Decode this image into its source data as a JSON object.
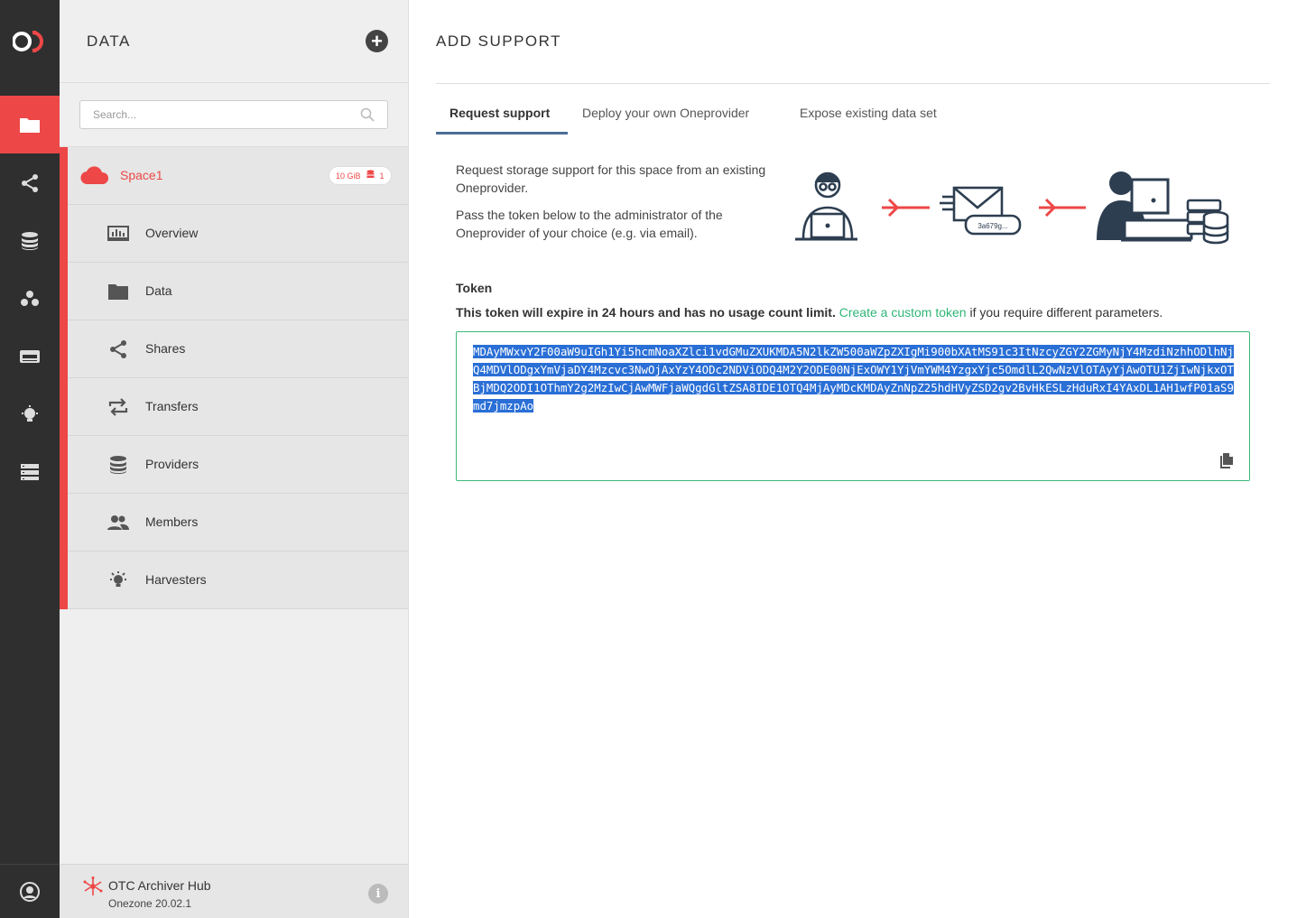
{
  "app": {
    "logo_icon": "onedata-logo-icon",
    "rail_items": [
      {
        "icon": "folder-icon",
        "active": true
      },
      {
        "icon": "share-icon",
        "active": false
      },
      {
        "icon": "database-icon",
        "active": false
      },
      {
        "icon": "groups-icon",
        "active": false
      },
      {
        "icon": "token-icon",
        "active": false
      },
      {
        "icon": "harvester-icon",
        "active": false
      },
      {
        "icon": "clusters-icon",
        "active": false
      }
    ],
    "user_icon": "user-icon",
    "accent": "#ed4747",
    "rail_color": "#2f2f2f"
  },
  "sidebar": {
    "title": "DATA",
    "add_icon": "plus-icon",
    "search": {
      "placeholder": "Search...",
      "value": ""
    },
    "space": {
      "name": "Space1",
      "size": "10 GiB",
      "providers_count": "1",
      "items": [
        {
          "label": "Overview",
          "icon": "overview-icon"
        },
        {
          "label": "Data",
          "icon": "folder-icon"
        },
        {
          "label": "Shares",
          "icon": "share-icon"
        },
        {
          "label": "Transfers",
          "icon": "transfers-icon"
        },
        {
          "label": "Providers",
          "icon": "database-icon"
        },
        {
          "label": "Members",
          "icon": "members-icon"
        },
        {
          "label": "Harvesters",
          "icon": "harvester-icon"
        }
      ]
    },
    "footer": {
      "hub": "OTC Archiver Hub",
      "version": "Onezone 20.02.1",
      "info": "i"
    }
  },
  "main": {
    "title": "ADD SUPPORT",
    "tabs": [
      {
        "label": "Request support",
        "active": true
      },
      {
        "label": "Deploy your own Oneprovider",
        "active": false
      },
      {
        "label": "Expose existing data set",
        "active": false
      }
    ],
    "description": [
      "Request storage support for this space from an existing Oneprovider.",
      "Pass the token below to the administrator of the Oneprovider of your choice (e.g. via email)."
    ],
    "illustration_token": "3a679g...",
    "token_title": "Token",
    "token_note_bold": "This token will expire in 24 hours and has no usage count limit.",
    "token_note_link": "Create a custom token",
    "token_note_rest": " if you require different parameters.",
    "token_value": "MDAyMWxvY2F00aW9uIGh1Yi5hcmNoaXZlci1vdGMuZXUKMDA5N2lkZW500aWZpZXIgMi900bXAtMS91c3ItNzcyZGY2ZGMyNjY4MzdiNzhhODlhNjQ4MDVlODgxYmVjaDY4Mzcvc3NwOjAxYzY4ODc2NDViODQ4M2Y2ODE00NjExOWY1YjVmYWM4YzgxYjc5OmdlL2QwNzVlOTAyYjAwOTU1ZjIwNjkxOTBjMDQ2ODI1OThmY2g2MzIwCjAwMWFjaWQgdGltZSA8IDE1OTQ4MjAyMDcKMDAyZnNpZ25hdHVyZSD2gv2BvHkESLzHduRxI4YAxDL1AH1wfP01aS9md7jmzpAo",
    "copy_icon": "copy-icon",
    "token_border": "#3cb878",
    "link_color": "#2fb676"
  }
}
